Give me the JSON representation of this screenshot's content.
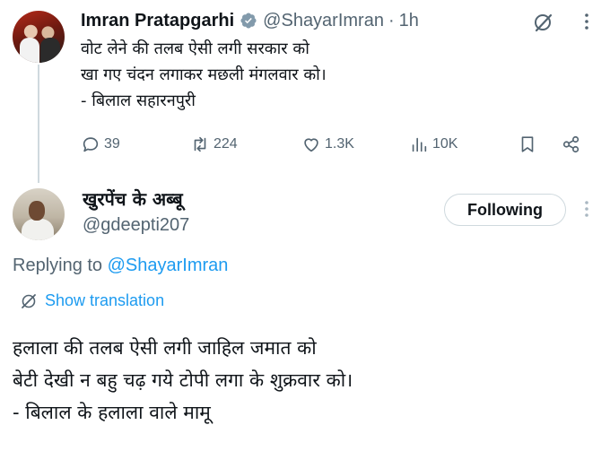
{
  "parent_tweet": {
    "author_name": "Imran Pratapgarhi",
    "handle": "@ShayarImran",
    "separator": "·",
    "time": "1h",
    "text_lines": [
      "वोट लेने की तलब ऐसी लगी सरकार को",
      "खा गए चंदन लगाकर मछली मंगलवार को।",
      "- बिलाल सहारनपुरी"
    ],
    "stats": {
      "replies": "39",
      "reposts": "224",
      "likes": "1.3K",
      "views": "10K"
    },
    "verified_color": "#829aab"
  },
  "reply_tweet": {
    "author_name": "खुरपेंच के अब्बू",
    "handle": "@gdeepti207",
    "follow_label": "Following",
    "replying_prefix": "Replying to ",
    "replying_mention": "@ShayarImran",
    "translate_label": "Show translation",
    "text_lines": [
      "हलाला की तलब ऐसी लगी जाहिल जमात को",
      "बेटी देखी न बहु चढ़ गये टोपी लगा के शुक्रवार को।",
      "- बिलाल के हलाला वाले मामू"
    ]
  },
  "colors": {
    "text_primary": "#0f1419",
    "text_secondary": "#536471",
    "accent": "#1d9bf0",
    "border": "#cfd9de"
  },
  "icons": {
    "verified": "verified-badge-icon",
    "grok": "grok-icon",
    "more": "more-icon",
    "reply": "reply-icon",
    "repost": "repost-icon",
    "like": "like-icon",
    "views": "views-icon",
    "bookmark": "bookmark-icon",
    "share": "share-icon",
    "translate": "translate-icon"
  }
}
